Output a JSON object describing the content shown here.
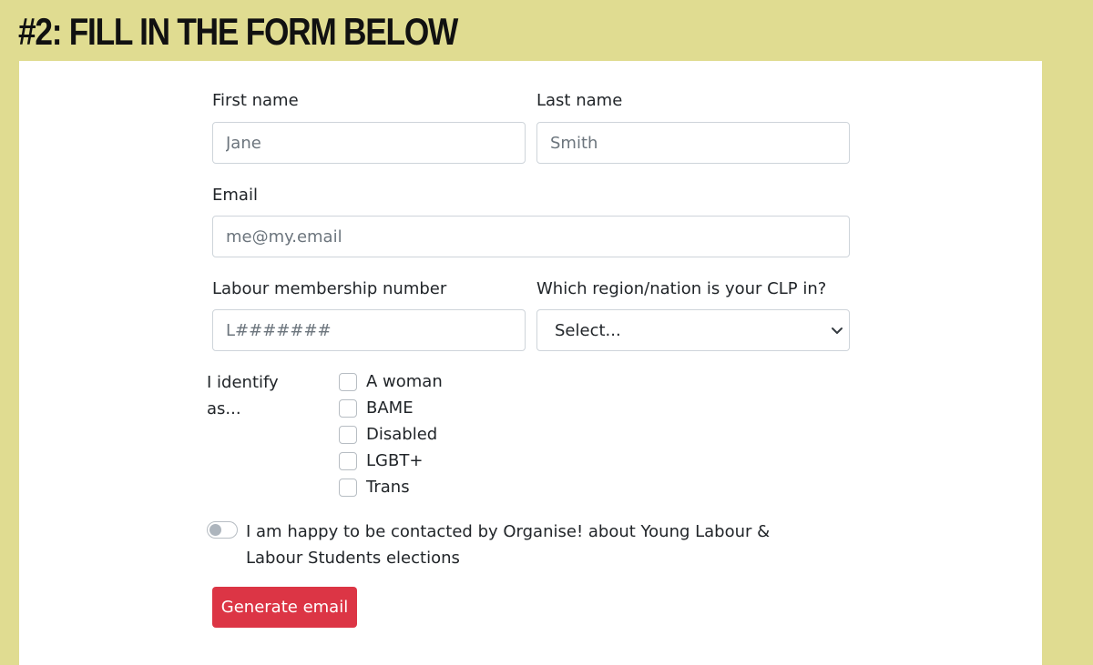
{
  "heading": "#2: FILL IN THE FORM BELOW",
  "form": {
    "first_name": {
      "label": "First name",
      "placeholder": "Jane"
    },
    "last_name": {
      "label": "Last name",
      "placeholder": "Smith"
    },
    "email": {
      "label": "Email",
      "placeholder": "me@my.email"
    },
    "membership": {
      "label": "Labour membership number",
      "placeholder": "L#######"
    },
    "region": {
      "label": "Which region/nation is your CLP in?",
      "selected": "Select..."
    },
    "identify_label_1": "I identify",
    "identify_label_2": "as...",
    "identities": [
      "A woman",
      "BAME",
      "Disabled",
      "LGBT+",
      "Trans"
    ],
    "consent_label": "I am happy to be contacted by Organise! about Young Labour & Labour Students elections",
    "submit_label": "Generate email"
  },
  "colors": {
    "background": "#e0dc91",
    "button": "#dc3545"
  },
  "icons": {
    "select_arrow": "chevron-down-icon"
  }
}
